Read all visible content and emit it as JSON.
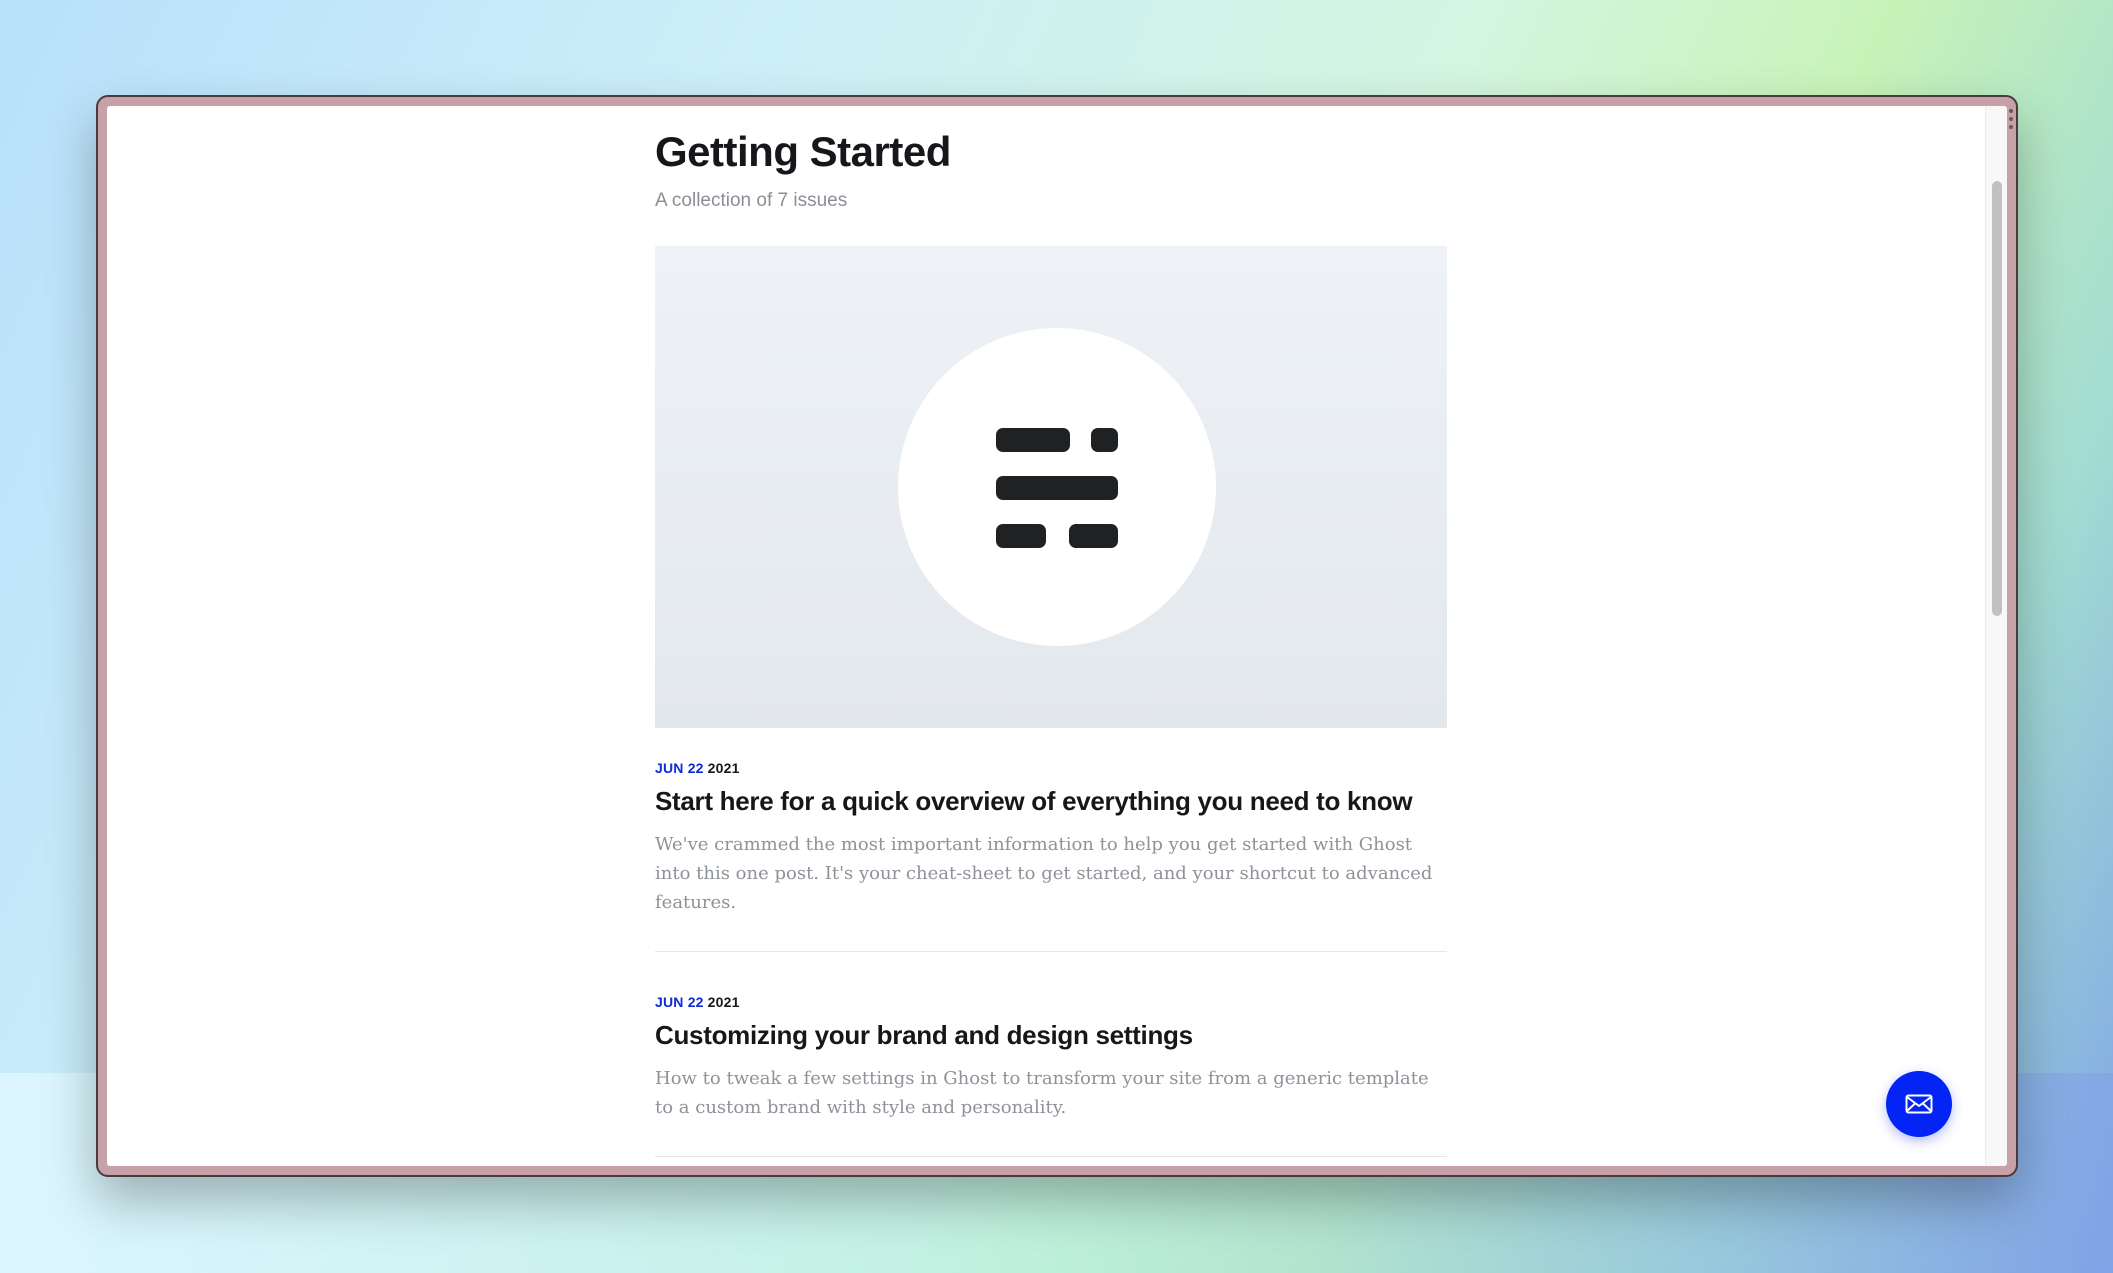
{
  "page": {
    "title": "Getting Started",
    "subtitle": "A collection of 7 issues"
  },
  "posts": [
    {
      "date_month_day": "JUN 22",
      "date_year": "2021",
      "title": "Start here for a quick overview of everything you need to know",
      "excerpt": "We've crammed the most important information to help you get started with Ghost into this one post. It's your cheat-sheet to get started, and your shortcut to advanced features."
    },
    {
      "date_month_day": "JUN 22",
      "date_year": "2021",
      "title": "Customizing your brand and design settings",
      "excerpt": "How to tweak a few settings in Ghost to transform your site from a generic template to a custom brand with style and personality."
    }
  ],
  "icons": {
    "feature_logo": "ghost-logo-icon",
    "subscribe": "mail-icon"
  },
  "colors": {
    "accent": "#0324f5",
    "date_accent": "#0d2bd8",
    "text_primary": "#15171a",
    "text_muted": "#8b8f95"
  }
}
